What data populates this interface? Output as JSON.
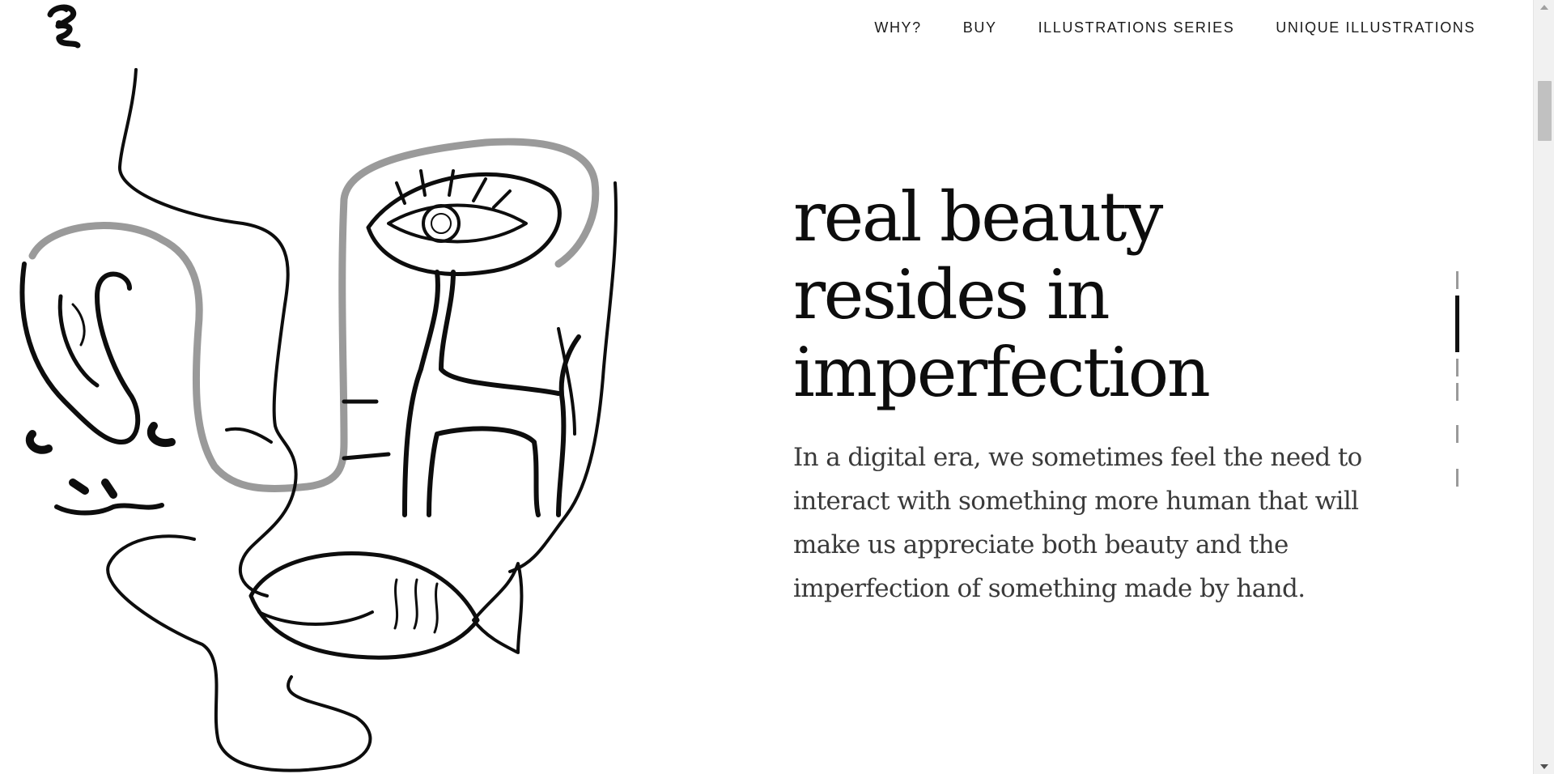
{
  "header": {
    "logo_icon": "ink-squiggle-logo-icon",
    "nav": [
      {
        "label": "WHY?"
      },
      {
        "label": "BUY"
      },
      {
        "label": "ILLUSTRATIONS SERIES"
      },
      {
        "label": "UNIQUE ILLUSTRATIONS"
      }
    ]
  },
  "hero": {
    "title": "real beauty resides in imperfection",
    "body": "In a digital era, we sometimes feel the need to interact with something more human that will make us appreciate both beauty and the imperfection of something made by hand.",
    "illustration_icon": "line-art-face-with-eye-horse-fish-icon",
    "slider": {
      "slide_count": 6,
      "active_index": 1
    }
  },
  "colors": {
    "ink": "#0d0d0d",
    "text": "#3a3a3a",
    "background": "#ffffff",
    "indicator_inactive": "#9a9a9a"
  }
}
